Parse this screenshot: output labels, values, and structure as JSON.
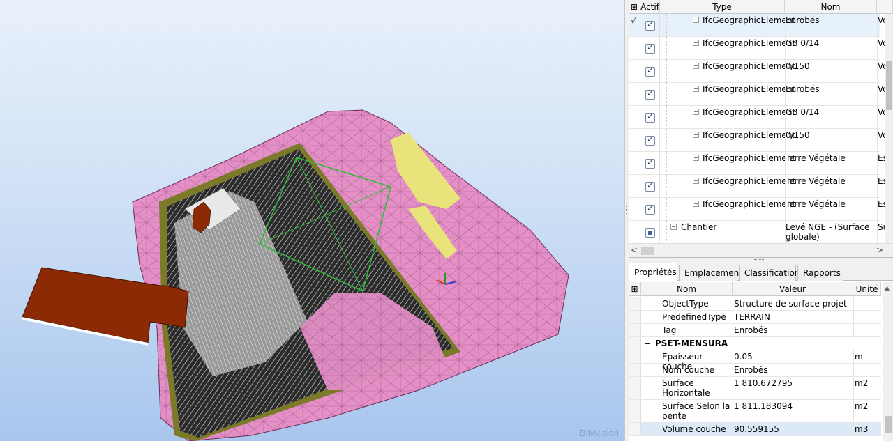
{
  "viewport": {
    "watermark": "BIMvision"
  },
  "elements_grid": {
    "columns": {
      "actif": "Actif",
      "type": "Type",
      "nom": "Nom"
    },
    "rows": [
      {
        "mark": "√",
        "checked": true,
        "type": "IfcGeographicElement",
        "nom": "Enrobés",
        "extra": "Vo | E",
        "selected": true
      },
      {
        "mark": "",
        "checked": true,
        "type": "IfcGeographicElement",
        "nom": "GB 0/14",
        "extra": "Vo | C"
      },
      {
        "mark": "",
        "checked": true,
        "type": "IfcGeographicElement",
        "nom": "0/150",
        "extra": "Vo | C"
      },
      {
        "mark": "",
        "checked": true,
        "type": "IfcGeographicElement",
        "nom": "Enrobés",
        "extra": "Vo | E"
      },
      {
        "mark": "",
        "checked": true,
        "type": "IfcGeographicElement",
        "nom": "GB 0/14",
        "extra": "Vo | C"
      },
      {
        "mark": "",
        "checked": true,
        "type": "IfcGeographicElement",
        "nom": "0/150",
        "extra": "Vo | C"
      },
      {
        "mark": "",
        "checked": true,
        "type": "IfcGeographicElement",
        "nom": "Terre Végétale",
        "extra": "Es | T"
      },
      {
        "mark": "",
        "checked": true,
        "type": "IfcGeographicElement",
        "nom": "Terre Végétale",
        "extra": "Es | T"
      },
      {
        "mark": "",
        "checked": true,
        "type": "IfcGeographicElement",
        "nom": "Terre Végétale",
        "extra": "Es | T"
      },
      {
        "mark": "",
        "checked": "partial",
        "type": "Chantier",
        "nom": "Levé NGE - (Surface globale)",
        "extra": "Su (S"
      }
    ]
  },
  "tabs": [
    "Propriétés",
    "Emplacement",
    "Classification",
    "Rapports"
  ],
  "properties": {
    "columns": {
      "nom": "Nom",
      "valeur": "Valeur",
      "unite": "Unité"
    },
    "rows_before": [
      {
        "name": "ObjectType",
        "value": "Structure de surface projet",
        "unit": ""
      },
      {
        "name": "PredefinedType",
        "value": "TERRAIN",
        "unit": ""
      },
      {
        "name": "Tag",
        "value": "Enrobés",
        "unit": ""
      }
    ],
    "group": "PSET-MENSURA",
    "rows_after": [
      {
        "name": "Epaisseur couche",
        "value": "0.05",
        "unit": "m"
      },
      {
        "name": "Nom couche",
        "value": "Enrobés",
        "unit": ""
      },
      {
        "name": "Surface Horizontale",
        "value": "1 810.672795",
        "unit": "m2"
      },
      {
        "name": "Surface Selon la pente",
        "value": "1 811.183094",
        "unit": "m2"
      },
      {
        "name": "Volume couche",
        "value": "90.559155",
        "unit": "m3"
      }
    ]
  }
}
